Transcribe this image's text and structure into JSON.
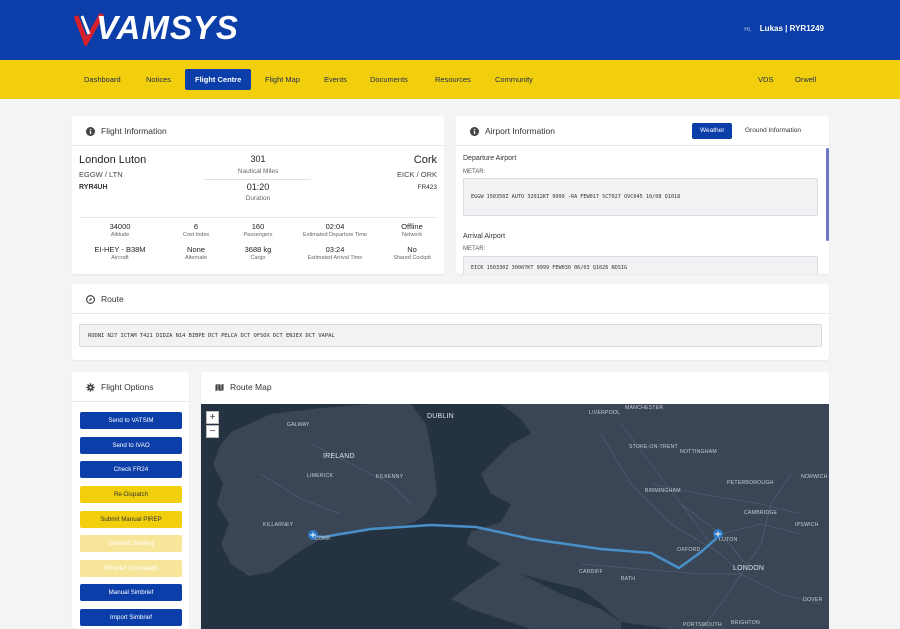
{
  "header": {
    "logo_text": "VAMSYS",
    "greeting_prefix": "Hi,",
    "user": "Lukas | RYR1249"
  },
  "nav": {
    "left": [
      "Dashboard",
      "Notices",
      "Flight Centre",
      "Flight Map",
      "Events",
      "Documents",
      "Resources",
      "Community"
    ],
    "right": [
      "VDS",
      "Orwell"
    ],
    "active": "Flight Centre"
  },
  "flight_info": {
    "title": "Flight Information",
    "dep_city": "London Luton",
    "dep_codes": "EGGW / LTN",
    "callsign": "RYR4UH",
    "distance": "301",
    "distance_unit": "Nautical Miles",
    "duration": "01:20",
    "duration_label": "Duration",
    "arr_city": "Cork",
    "arr_codes": "EICK / ORK",
    "flight_number": "FR423",
    "stats_row1": [
      {
        "value": "34000",
        "label": "Altitude"
      },
      {
        "value": "6",
        "label": "Cost Index"
      },
      {
        "value": "160",
        "label": "Passengers"
      },
      {
        "value": "02:04",
        "label": "Estimated Departure Time"
      },
      {
        "value": "Offline",
        "label": "Network"
      }
    ],
    "stats_row2": [
      {
        "value": "EI-HEY - B38M",
        "label": "Aircraft"
      },
      {
        "value": "None",
        "label": "Alternate"
      },
      {
        "value": "3688 kg",
        "label": "Cargo"
      },
      {
        "value": "03:24",
        "label": "Estimated Arrival Time"
      },
      {
        "value": "No",
        "label": "Shared Cockpit"
      }
    ]
  },
  "airport_info": {
    "title": "Airport Information",
    "tabs": [
      "Weather",
      "Ground Information"
    ],
    "active_tab": "Weather",
    "departure_heading": "Departure Airport",
    "departure_metar_label": "METAR:",
    "departure_metar": "EGGW 150350Z AUTO 32012KT 9999 -RA FEW017 SCT027 OVC045 10/08 Q1018",
    "arrival_heading": "Arrival Airport",
    "arrival_metar_label": "METAR:",
    "arrival_metar": "EICK 150330Z 30007KT 9999 FEW030 06/03 Q1026 NOSIG"
  },
  "route": {
    "title": "Route",
    "string": "RODNI N27 ICTAM T421 DIDZA N14 BIBPE DCT PELCA DCT OFSOX DCT ENJEX DCT VAPAL"
  },
  "flight_options": {
    "title": "Flight Options",
    "buttons": [
      {
        "label": "Send to VATSIM",
        "style": "blue"
      },
      {
        "label": "Send to IVAO",
        "style": "blue"
      },
      {
        "label": "Check FR24",
        "style": "blue"
      },
      {
        "label": "Re-Dispatch",
        "style": "yellow"
      },
      {
        "label": "Submit Manual PIREP",
        "style": "yellow"
      },
      {
        "label": "Simbrief Briefing",
        "style": "pale"
      },
      {
        "label": "Simbrief Downloads",
        "style": "pale"
      },
      {
        "label": "Manual Simbrief",
        "style": "blue"
      },
      {
        "label": "Import Simbrief",
        "style": "blue"
      }
    ]
  },
  "route_map": {
    "title": "Route Map",
    "zoom_in": "+",
    "zoom_out": "−",
    "labels": [
      "DUBLIN",
      "LIVERPOOL",
      "MANCHESTER",
      "GALWAY",
      "IRELAND",
      "LIMERICK",
      "KILKENNY",
      "STOKE-ON-TRENT",
      "NOTTINGHAM",
      "NORWICH",
      "PETERBOROUGH",
      "BIRMINGHAM",
      "CAMBRIDGE",
      "IPSWICH",
      "KILLARNEY",
      "CORK",
      "OXFORD",
      "LUTON",
      "LONDON",
      "CARDIFF",
      "BATH",
      "DOVER",
      "PORTSMOUTH",
      "BRIGHTON"
    ]
  },
  "colors": {
    "brand_blue": "#0b3ea8",
    "brand_yellow": "#f2cf0c",
    "logo_red": "#d6202c",
    "route_line": "#4a90c8"
  }
}
